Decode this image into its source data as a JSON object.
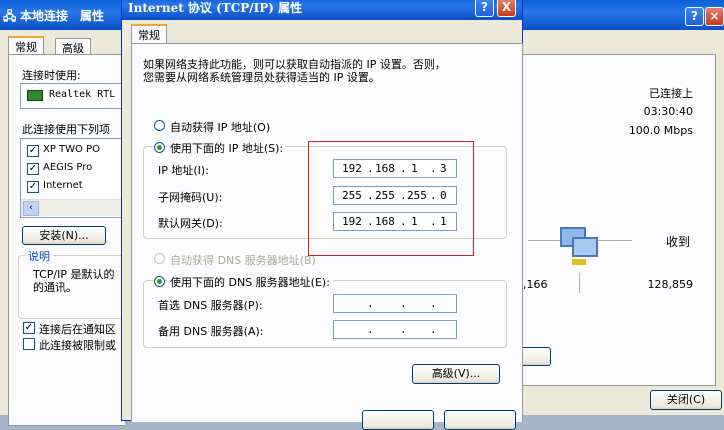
{
  "back_window": {
    "title": "本地连接　属性",
    "title_visible": "本地连接　属性",
    "help_btn": "?",
    "tabs": [
      "常规",
      "高级"
    ],
    "connect_using_label": "连接时使用:",
    "adapter_name": "Realtek RTL",
    "components_label": "此连接使用下列项",
    "components": [
      "XP TWO PO",
      "AEGIS Pro",
      "Internet"
    ],
    "install_button": "安装(N)...",
    "description_legend": "说明",
    "description_text_1": "TCP/IP 是默认的",
    "description_text_2": "的通讯。",
    "notify_label": "连接后在通知区",
    "limited_label": "此连接被限制或"
  },
  "status_window": {
    "help_btn": "?",
    "status": "已连接上",
    "duration": "03:30:40",
    "speed": "100.0 Mbps",
    "received_label": "收到",
    "sent_count": "7,166",
    "received_count": "128,859",
    "close_button": "关闭(C)"
  },
  "tcpip": {
    "title": "Internet 协议 (TCP/IP) 属性",
    "help_btn": "?",
    "close_btn": "X",
    "tab": "常规",
    "intro_1": "如果网络支持此功能，则可以获取自动指派的 IP 设置。否则，",
    "intro_2": "您需要从网络系统管理员处获得适当的 IP 设置。",
    "auto_ip": "自动获得 IP 地址(O)",
    "manual_ip": "使用下面的 IP 地址(S):",
    "ip_label": "IP 地址(I):",
    "mask_label": "子网掩码(U):",
    "gateway_label": "默认网关(D):",
    "ip": [
      "192",
      "168",
      "1",
      "3"
    ],
    "mask": [
      "255",
      "255",
      "255",
      "0"
    ],
    "gateway": [
      "192",
      "168",
      "1",
      "1"
    ],
    "auto_dns": "自动获得 DNS 服务器地址(B)",
    "manual_dns": "使用下面的 DNS 服务器地址(E):",
    "pref_dns_label": "首选 DNS 服务器(P):",
    "alt_dns_label": "备用 DNS 服务器(A):",
    "advanced_button": "高级(V)..."
  }
}
